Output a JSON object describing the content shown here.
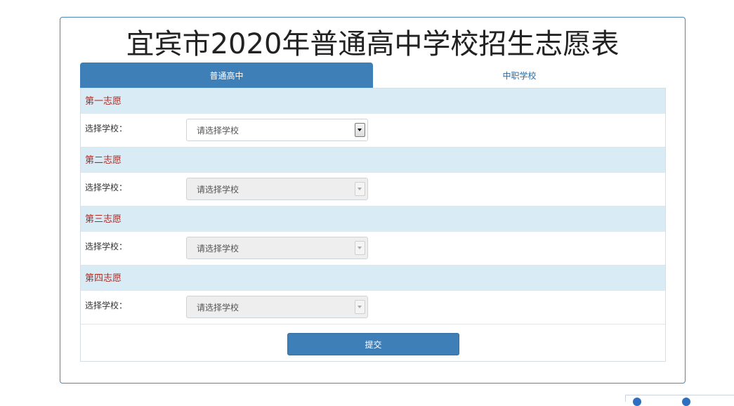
{
  "page": {
    "title": "宜宾市2020年普通高中学校招生志愿表"
  },
  "tabs": [
    {
      "label": "普通高中",
      "active": true
    },
    {
      "label": "中职学校",
      "active": false
    }
  ],
  "choices": [
    {
      "heading": "第一志愿",
      "label": "选择学校：",
      "select_value": "请选择学校",
      "enabled": true
    },
    {
      "heading": "第二志愿",
      "label": "选择学校：",
      "select_value": "请选择学校",
      "enabled": false
    },
    {
      "heading": "第三志愿",
      "label": "选择学校：",
      "select_value": "请选择学校",
      "enabled": false
    },
    {
      "heading": "第四志愿",
      "label": "选择学校：",
      "select_value": "请选择学校",
      "enabled": false
    }
  ],
  "submit_label": "提交",
  "colors": {
    "primary": "#3f7fb8",
    "section_bg": "#d9ebf4",
    "section_text": "#b02a24",
    "tab_inactive_text": "#2b6aa5"
  },
  "icons": {
    "dropdown": "chevron-down-icon"
  }
}
